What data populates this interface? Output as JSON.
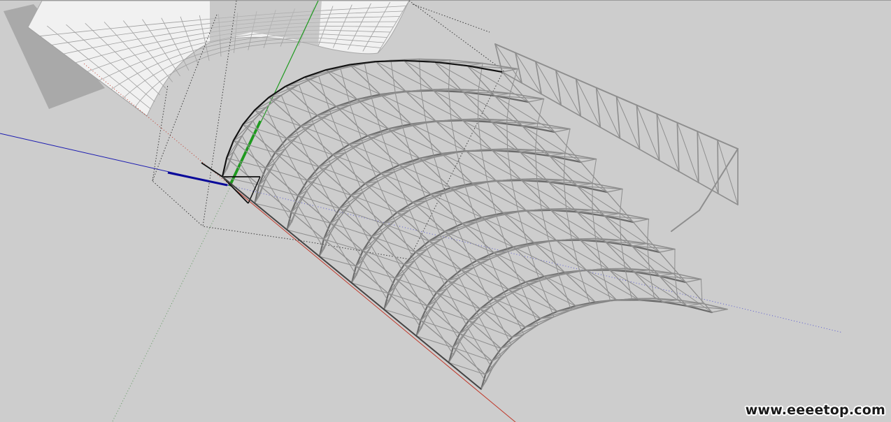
{
  "watermark": {
    "text": "www.eeeetop.com"
  },
  "viewport": {
    "background": "#cdcdcd",
    "axis_colors": {
      "red": "#c0392b",
      "green": "#1f9a1f",
      "blue": "#1b1bb0"
    },
    "structure_color": "#8e8e8e",
    "edge_color": "#111111"
  }
}
